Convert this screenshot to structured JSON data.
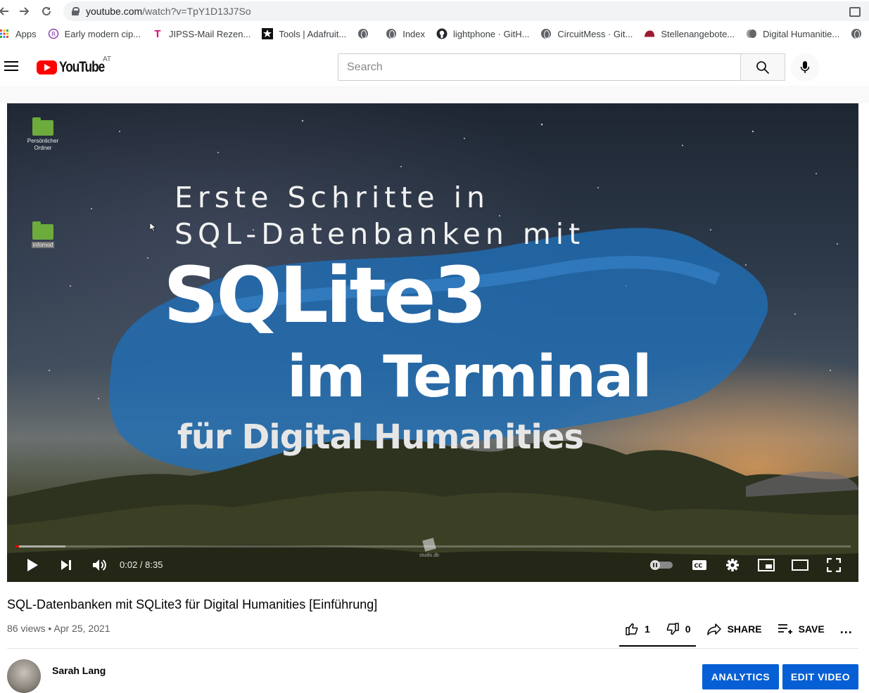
{
  "browser": {
    "url_host": "youtube.com",
    "url_path": "/watch?v=TpY1D13J7So",
    "bookmarks": [
      {
        "label": "Apps",
        "icon": "apps-grid-icon"
      },
      {
        "label": "Early modern cip...",
        "icon": "r-circle-icon"
      },
      {
        "label": "JIPSS-Mail Rezen...",
        "icon": "telekom-icon"
      },
      {
        "label": "Tools | Adafruit...",
        "icon": "adafruit-star-icon"
      },
      {
        "label": "",
        "icon": "globe-icon"
      },
      {
        "label": "Index",
        "icon": "globe-icon"
      },
      {
        "label": "lightphone · GitH...",
        "icon": "github-icon"
      },
      {
        "label": "CircuitMess · Git...",
        "icon": "globe-icon"
      },
      {
        "label": "Stellenangebote...",
        "icon": "hat-icon"
      },
      {
        "label": "Digital Humanitie...",
        "icon": "dh-icon"
      }
    ]
  },
  "youtube": {
    "logo_text": "YouTube",
    "country": "AT",
    "search_placeholder": "Search"
  },
  "video": {
    "desktop_icons": [
      {
        "label": "Persönlicher Ordner"
      },
      {
        "label": "infomod"
      }
    ],
    "overlay": {
      "line1": "Erste Schritte in",
      "line2": "SQL-Datenbanken mit",
      "big": "SQLite3",
      "line3": "im Terminal",
      "line4": "für Digital Humanities"
    },
    "file_icon_label": "studis.db",
    "time": "0:02 / 8:35",
    "played_fraction": 0.004,
    "buffered_fraction": 0.06
  },
  "info": {
    "title": "SQL-Datenbanken mit SQLite3 für Digital Humanities [Einführung]",
    "meta": "86 views • Apr 25, 2021",
    "likes": "1",
    "dislikes": "0",
    "share_label": "SHARE",
    "save_label": "SAVE",
    "more_label": "..."
  },
  "channel": {
    "name": "Sarah Lang",
    "analytics_label": "ANALYTICS",
    "edit_label": "EDIT VIDEO"
  },
  "colors": {
    "yt_red": "#ff0000",
    "blue_button": "#065fd4",
    "brush_blue": "#1f6fb8"
  }
}
